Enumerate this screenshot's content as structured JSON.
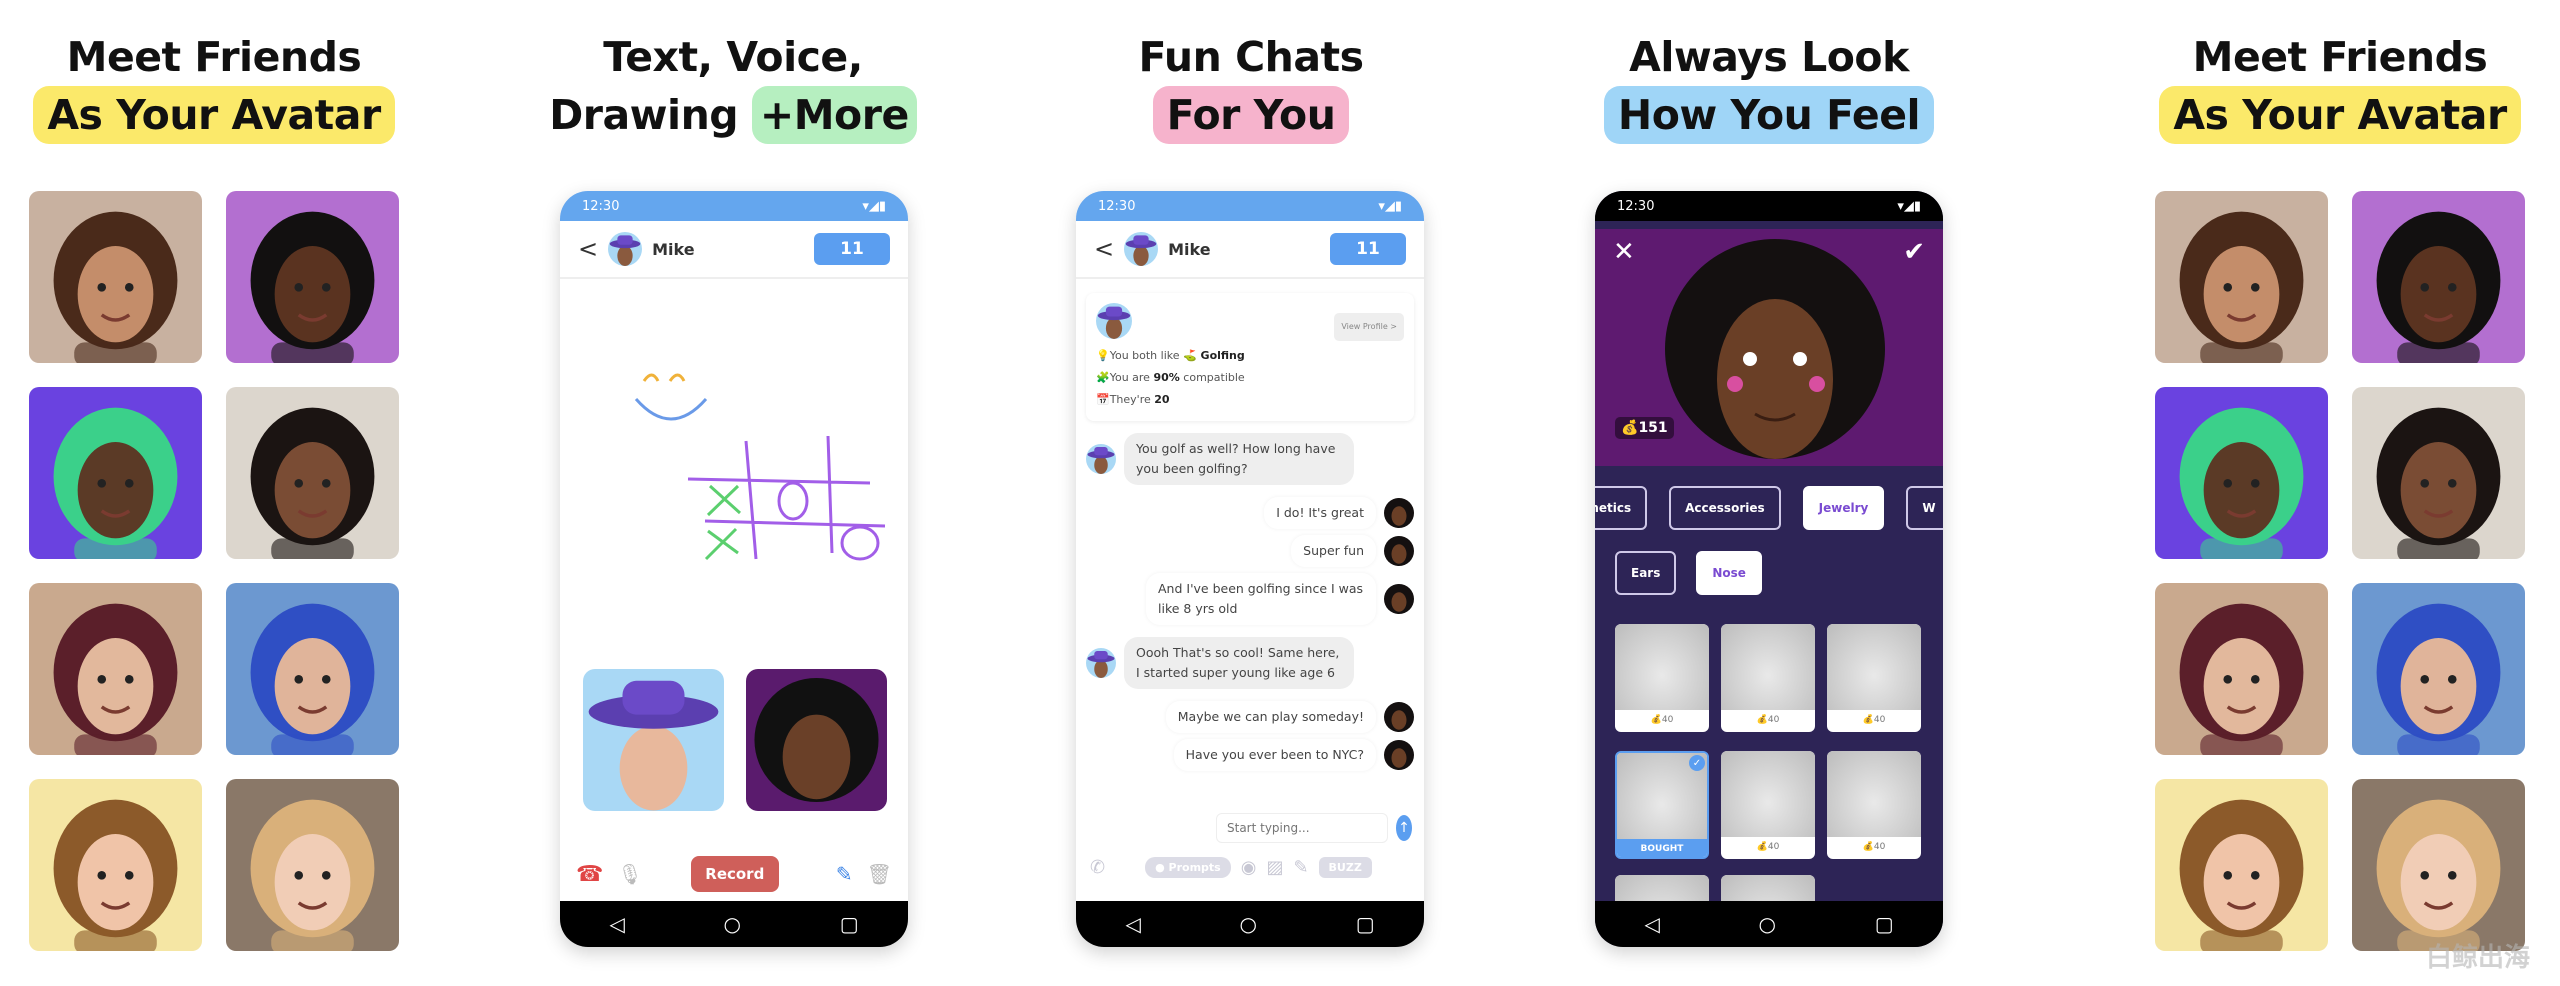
{
  "panels": [
    {
      "line1": "Meet Friends",
      "line2": "As Your Avatar",
      "highlight": "#fbe96a"
    },
    {
      "line1": "Text, Voice,",
      "line2a": "Drawing",
      "line2": "+More",
      "highlight": "#b6efc0"
    },
    {
      "line1": "Fun Chats",
      "line2": "For You",
      "highlight": "#f6b3cc"
    },
    {
      "line1": "Always Look",
      "line2": "How You Feel",
      "highlight": "#9fd5f7"
    },
    {
      "line1": "Meet Friends",
      "line2": "As Your Avatar",
      "highlight": "#fbe96a"
    }
  ],
  "avatar_tiles": [
    {
      "bg": "#c8b1a0",
      "skin": "#c48d6a",
      "hair": "#4a2a1a"
    },
    {
      "bg": "#b36fd0",
      "skin": "#5a3320",
      "hair": "#121010"
    },
    {
      "bg": "#6a42e0",
      "skin": "#5b3a26",
      "hair": "#3bd08a"
    },
    {
      "bg": "#dcd6cd",
      "skin": "#7a4c34",
      "hair": "#1b1412"
    },
    {
      "bg": "#c9a98e",
      "skin": "#e2b89c",
      "hair": "#5b1f2a"
    },
    {
      "bg": "#6c98d0",
      "skin": "#e0b49a",
      "hair": "#2f4fc4"
    },
    {
      "bg": "#f5e6a4",
      "skin": "#f0c4a8",
      "hair": "#8c5a2a"
    },
    {
      "bg": "#8a7868",
      "skin": "#f1cdb6",
      "hair": "#d9b07a"
    }
  ],
  "status": {
    "time": "12:30",
    "icons": "▾◢▮"
  },
  "chat_header": {
    "back": "<",
    "name": "Mike",
    "count": "11"
  },
  "drawing": {
    "record_label": "Record"
  },
  "chat": {
    "view_profile": "View Profile >",
    "facts": [
      {
        "icon": "💡",
        "pre": "You both like ",
        "bold": "⛳ Golfing",
        "post": ""
      },
      {
        "icon": "🧩",
        "pre": "You are ",
        "bold": "90%",
        "post": " compatible"
      },
      {
        "icon": "📅",
        "pre": "They're ",
        "bold": "20",
        "post": ""
      }
    ],
    "messages": [
      {
        "from": "them",
        "text": "You golf as well? How long have you been golfing?"
      },
      {
        "from": "me",
        "text": "I do! It's great"
      },
      {
        "from": "me",
        "text": "Super fun"
      },
      {
        "from": "me",
        "text": "And I've been golfing since I was like 8 yrs old"
      },
      {
        "from": "them",
        "text": "Oooh That's so cool! Same here, I started super young like age 6"
      },
      {
        "from": "me",
        "text": "Maybe we can play someday!"
      },
      {
        "from": "me",
        "text": "Have you ever been to NYC?"
      }
    ],
    "input_placeholder": "Start typing...",
    "prompts_label": "Prompts",
    "buzz_label": "BUZZ"
  },
  "editor": {
    "coins": "151",
    "categories": [
      {
        "label": "osmetics",
        "sel": false
      },
      {
        "label": "Accessories",
        "sel": false
      },
      {
        "label": "Jewelry",
        "sel": true
      },
      {
        "label": "W",
        "sel": false
      }
    ],
    "subcategories": [
      {
        "label": "Ears",
        "sel": false
      },
      {
        "label": "Nose",
        "sel": true
      }
    ],
    "items": [
      {
        "label": "💰40",
        "sel": false
      },
      {
        "label": "💰40",
        "sel": false
      },
      {
        "label": "💰40",
        "sel": false
      },
      {
        "label": "BOUGHT",
        "sel": true
      },
      {
        "label": "💰40",
        "sel": false
      },
      {
        "label": "💰40",
        "sel": false
      },
      {
        "label": "",
        "sel": false
      },
      {
        "label": "",
        "sel": false
      }
    ]
  },
  "watermark": "白鲸出海"
}
